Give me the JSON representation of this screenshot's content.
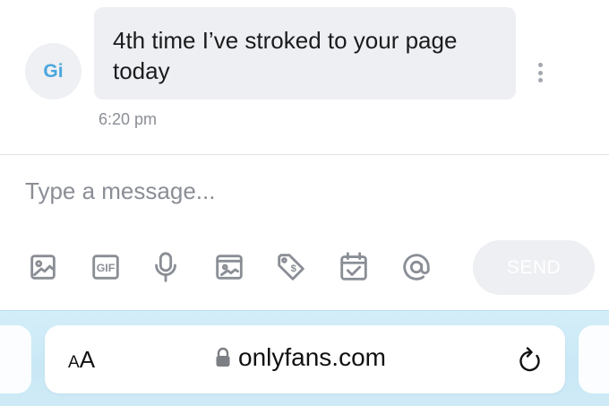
{
  "chat": {
    "avatar_initials": "Gi",
    "message_text": "4th time I’ve stroked to your page today",
    "timestamp": "6:20 pm",
    "more_icon": "vertical-ellipsis-icon"
  },
  "composer": {
    "placeholder": "Type a message...",
    "send_label": "SEND",
    "tools": [
      "image-icon",
      "gif-icon",
      "microphone-icon",
      "media-vault-icon",
      "price-tag-icon",
      "schedule-calendar-icon",
      "mention-at-icon"
    ],
    "gif_label": "GIF"
  },
  "browser": {
    "text_size_small": "A",
    "text_size_big": "A",
    "url": "onlyfans.com",
    "lock_icon": "lock-icon",
    "reload_icon": "reload-icon"
  },
  "colors": {
    "avatar_text": "#4aa7dd",
    "bubble_bg": "#eeeff2",
    "icon_gray": "#8a8e95",
    "browser_bar": "#cfeaf7"
  }
}
